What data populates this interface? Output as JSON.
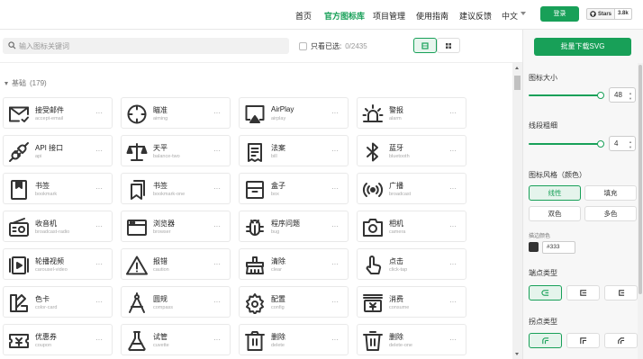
{
  "nav": {
    "items": [
      "首页",
      "官方图标库",
      "项目管理",
      "使用指南",
      "建议反馈"
    ],
    "active_index": 1,
    "language": "中文",
    "login_label": "登录",
    "github_label": "Stars",
    "github_count": "3.8k"
  },
  "toolbar": {
    "search_placeholder": "输入图标关键词",
    "only_selected_label": "只看已选:",
    "selected_count": "0/2435"
  },
  "section": {
    "title": "基础",
    "count": "(179)"
  },
  "icons": [
    {
      "name": "接受邮件",
      "en": "accept-email",
      "icon": "email-icon"
    },
    {
      "name": "瞄准",
      "en": "aiming",
      "icon": "aiming-icon"
    },
    {
      "name": "AirPlay",
      "en": "airplay",
      "icon": "airplay-icon"
    },
    {
      "name": "警报",
      "en": "alarm",
      "icon": "alarm-icon"
    },
    {
      "name": "API 接口",
      "en": "api",
      "icon": "api-plug-icon"
    },
    {
      "name": "天平",
      "en": "balance-two",
      "icon": "balance-icon"
    },
    {
      "name": "法案",
      "en": "bill",
      "icon": "bill-icon"
    },
    {
      "name": "蓝牙",
      "en": "bluetooth",
      "icon": "bluetooth-icon"
    },
    {
      "name": "书签",
      "en": "bookmark",
      "icon": "bookmark-icon"
    },
    {
      "name": "书签",
      "en": "bookmark-one",
      "icon": "bookmark-one-icon"
    },
    {
      "name": "盒子",
      "en": "box",
      "icon": "box-icon"
    },
    {
      "name": "广播",
      "en": "broadcast",
      "icon": "broadcast-icon"
    },
    {
      "name": "收音机",
      "en": "broadcast-radio",
      "icon": "radio-icon"
    },
    {
      "name": "浏览器",
      "en": "browser",
      "icon": "browser-icon"
    },
    {
      "name": "程序问题",
      "en": "bug",
      "icon": "bug-icon"
    },
    {
      "name": "相机",
      "en": "camera",
      "icon": "camera-icon"
    },
    {
      "name": "轮播视频",
      "en": "carousel-video",
      "icon": "carousel-video-icon"
    },
    {
      "name": "报错",
      "en": "caution",
      "icon": "caution-icon"
    },
    {
      "name": "清除",
      "en": "clear",
      "icon": "clear-icon"
    },
    {
      "name": "点击",
      "en": "click-tap",
      "icon": "click-tap-icon"
    },
    {
      "name": "色卡",
      "en": "color-card",
      "icon": "color-card-icon"
    },
    {
      "name": "圆规",
      "en": "compass",
      "icon": "compass-icon"
    },
    {
      "name": "配置",
      "en": "config",
      "icon": "config-icon"
    },
    {
      "name": "消费",
      "en": "consume",
      "icon": "consume-icon"
    },
    {
      "name": "优惠券",
      "en": "coupon",
      "icon": "coupon-icon"
    },
    {
      "name": "试管",
      "en": "cuvette",
      "icon": "cuvette-icon"
    },
    {
      "name": "删除",
      "en": "delete",
      "icon": "delete-icon"
    },
    {
      "name": "删除",
      "en": "delete-one",
      "icon": "delete-one-icon"
    }
  ],
  "panel": {
    "download_label": "批量下载SVG",
    "size_label": "图标大小",
    "size_value": "48",
    "stroke_label": "线段粗细",
    "stroke_value": "4",
    "style_label": "图标风格（颜色）",
    "styles": [
      "线性",
      "填充",
      "双色",
      "多色"
    ],
    "active_style": "线性",
    "stroke_color_label": "描边颜色",
    "stroke_color": "#333",
    "linecap_label": "端点类型",
    "linejoin_label": "拐点类型"
  },
  "colors": {
    "accent": "#18a058",
    "icon": "#333333"
  }
}
